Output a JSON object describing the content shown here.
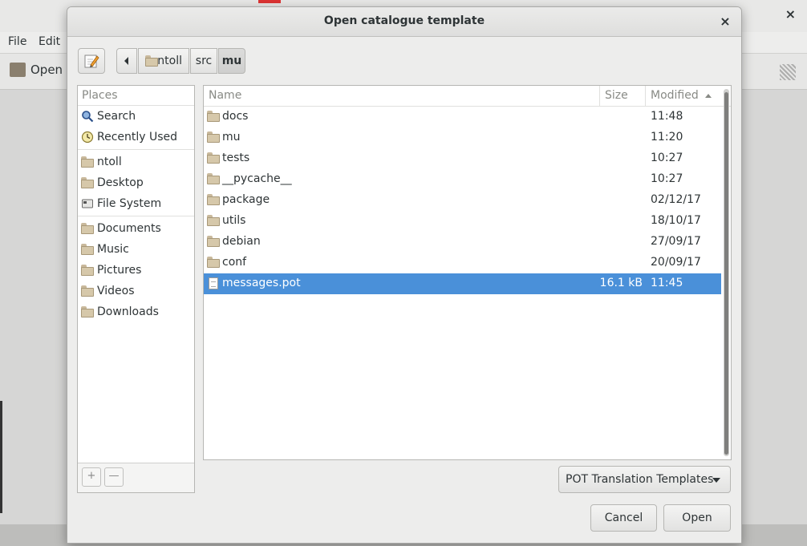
{
  "background": {
    "menu": {
      "file": "File",
      "edit": "Edit"
    },
    "toolbar": {
      "open": "Open"
    },
    "close": "×"
  },
  "dialog": {
    "title": "Open catalogue template",
    "close_glyph": "×",
    "breadcrumb": {
      "home": "ntoll",
      "src": "src",
      "mu": "mu"
    },
    "places": {
      "header": "Places",
      "items": [
        {
          "label": "Search",
          "icon": "search-icon"
        },
        {
          "label": "Recently Used",
          "icon": "recent-icon"
        },
        {
          "label": "ntoll",
          "icon": "home-folder-icon"
        },
        {
          "label": "Desktop",
          "icon": "desktop-folder-icon"
        },
        {
          "label": "File System",
          "icon": "drive-icon"
        },
        {
          "label": "Documents",
          "icon": "documents-folder-icon"
        },
        {
          "label": "Music",
          "icon": "music-folder-icon"
        },
        {
          "label": "Pictures",
          "icon": "pictures-folder-icon"
        },
        {
          "label": "Videos",
          "icon": "videos-folder-icon"
        },
        {
          "label": "Downloads",
          "icon": "downloads-folder-icon"
        }
      ],
      "add": "+",
      "remove": "—"
    },
    "columns": {
      "name": "Name",
      "size": "Size",
      "modified": "Modified"
    },
    "files": [
      {
        "name": "docs",
        "size": "",
        "modified": "11:48",
        "type": "folder"
      },
      {
        "name": "mu",
        "size": "",
        "modified": "11:20",
        "type": "folder"
      },
      {
        "name": "tests",
        "size": "",
        "modified": "10:27",
        "type": "folder"
      },
      {
        "name": "__pycache__",
        "size": "",
        "modified": "10:27",
        "type": "folder"
      },
      {
        "name": "package",
        "size": "",
        "modified": "02/12/17",
        "type": "folder"
      },
      {
        "name": "utils",
        "size": "",
        "modified": "18/10/17",
        "type": "folder"
      },
      {
        "name": "debian",
        "size": "",
        "modified": "27/09/17",
        "type": "folder"
      },
      {
        "name": "conf",
        "size": "",
        "modified": "20/09/17",
        "type": "folder"
      },
      {
        "name": "messages.pot",
        "size": "16.1 kB",
        "modified": "11:45",
        "type": "file",
        "selected": true
      }
    ],
    "filter": "POT Translation Templates",
    "cancel": "Cancel",
    "open": "Open"
  },
  "colors": {
    "selection": "#4a90d9",
    "background": "#ededec"
  }
}
